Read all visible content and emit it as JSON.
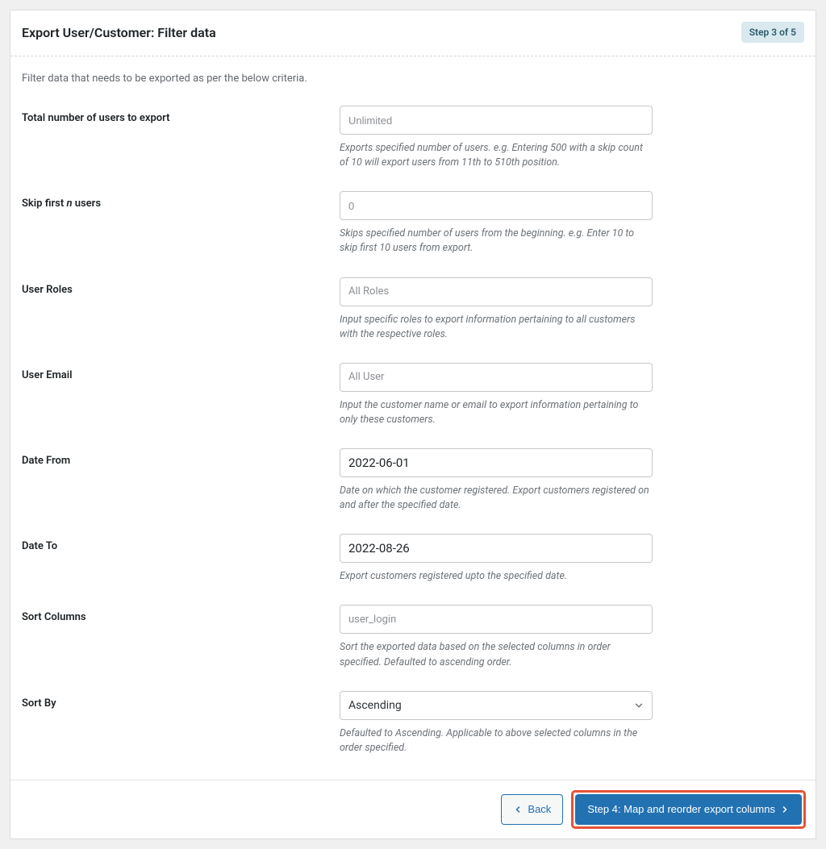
{
  "header": {
    "title": "Export User/Customer: Filter data",
    "step_badge": "Step 3 of 5"
  },
  "desc": "Filter data that needs to be exported as per the below criteria.",
  "fields": {
    "total_users": {
      "label": "Total number of users to export",
      "placeholder": "Unlimited",
      "value": "",
      "help": "Exports specified number of users. e.g. Entering 500 with a skip count of 10 will export users from 11th to 510th position."
    },
    "skip_first": {
      "label_pre": "Skip first ",
      "label_n": "n",
      "label_post": " users",
      "placeholder": "0",
      "value": "",
      "help": "Skips specified number of users from the beginning. e.g. Enter 10 to skip first 10 users from export."
    },
    "user_roles": {
      "label": "User Roles",
      "placeholder": "All Roles",
      "value": "",
      "help": "Input specific roles to export information pertaining to all customers with the respective roles."
    },
    "user_email": {
      "label": "User Email",
      "placeholder": "All User",
      "value": "",
      "help": "Input the customer name or email to export information pertaining to only these customers."
    },
    "date_from": {
      "label": "Date From",
      "value": "2022-06-01",
      "help": "Date on which the customer registered. Export customers registered on and after the specified date."
    },
    "date_to": {
      "label": "Date To",
      "value": "2022-08-26",
      "help": "Export customers registered upto the specified date."
    },
    "sort_columns": {
      "label": "Sort Columns",
      "value": "user_login",
      "help": "Sort the exported data based on the selected columns in order specified. Defaulted to ascending order."
    },
    "sort_by": {
      "label": "Sort By",
      "value": "Ascending",
      "help": "Defaulted to Ascending. Applicable to above selected columns in the order specified."
    }
  },
  "footer": {
    "back_label": "Back",
    "next_label": "Step 4: Map and reorder export columns"
  }
}
